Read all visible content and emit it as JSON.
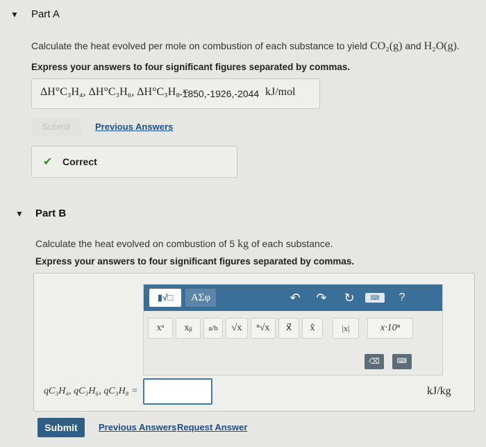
{
  "partA": {
    "title": "Part A",
    "prompt": "Calculate the heat evolved per mole on combustion of each substance to yield",
    "co2": "CO₂(g)",
    "and": "and",
    "h2o": "H₂O(g)",
    "period": ".",
    "instruction": "Express your answers to four significant figures separated by commas.",
    "answer_vars": "ΔH°C₃H₄, ΔH°C₃H₆, ΔH°C₃H₈ =",
    "answer_values": "-1850,-1926,-2044",
    "answer_unit": "kJ/mol",
    "submit_label": "Submit",
    "previous_answers": "Previous Answers",
    "status": "Correct"
  },
  "partB": {
    "title": "Part B",
    "prompt": "Calculate the heat evolved on combustion of 5",
    "mass_unit": "kg",
    "prompt_end": "of each substance.",
    "instruction": "Express your answers to four significant figures separated by commas.",
    "toolbar": {
      "greek_label": "ΑΣφ",
      "help_label": "?"
    },
    "symbols": [
      "xᵃ",
      "xᵦ",
      "a/b",
      "√x",
      "ⁿ√x",
      "x⃗",
      "x̂",
      "|x|",
      "x·10ⁿ"
    ],
    "answer_vars": "qC₃H₄, qC₃H₆, qC₃H₈ =",
    "input_value": "",
    "answer_unit": "kJ/kg",
    "submit_label": "Submit",
    "previous_answers": "Previous Answers",
    "request_answer": "Request Answer"
  }
}
